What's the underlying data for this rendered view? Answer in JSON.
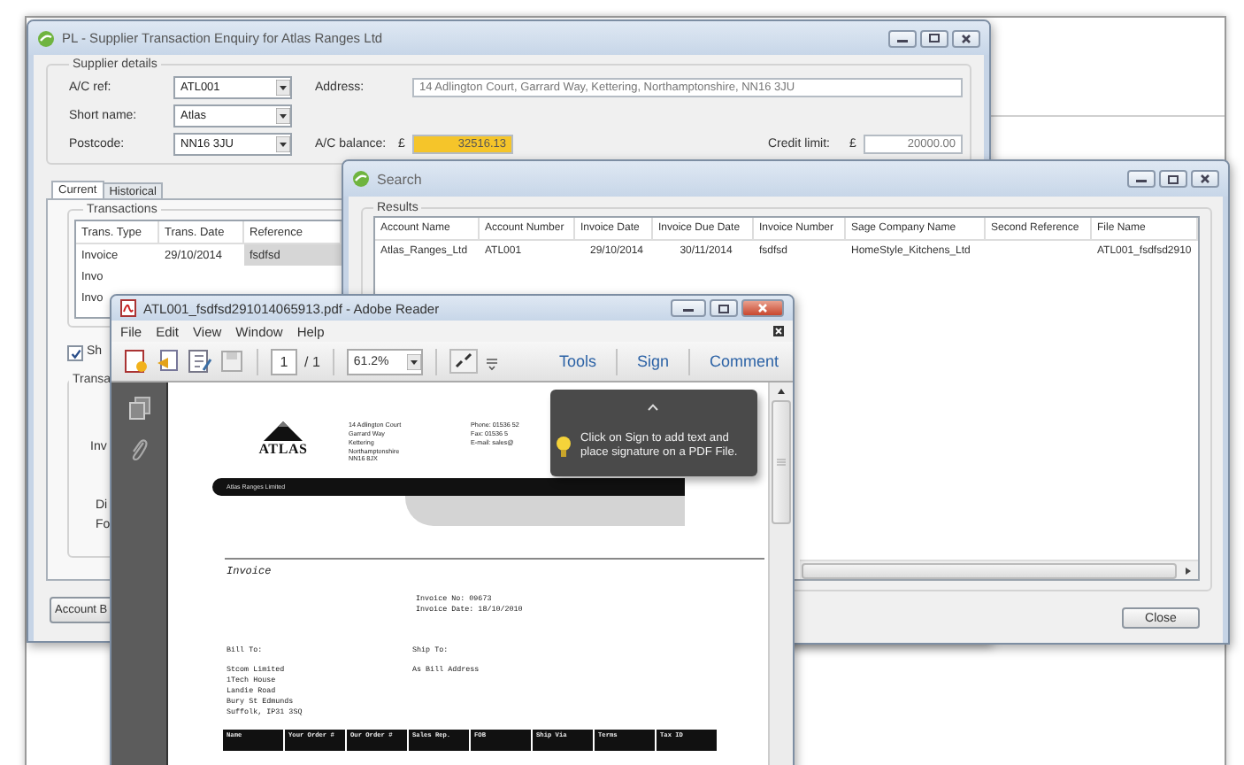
{
  "main_window": {
    "title": "PL - Supplier Transaction Enquiry for Atlas Ranges Ltd",
    "supplier_details": {
      "label": "Supplier details",
      "fields": [
        {
          "label": "A/C ref:",
          "value": "ATL001"
        },
        {
          "label": "Short name:",
          "value": "Atlas"
        },
        {
          "label": "Postcode:",
          "value": "NN16 3JU"
        }
      ],
      "address_label": "Address:",
      "address": "14 Adlington Court, Garrard Way, Kettering, Northamptonshire, NN16 3JU",
      "balance_label": "A/C balance:",
      "balance_currency": "£",
      "balance": "32516.13",
      "credit_label": "Credit limit:",
      "credit_currency": "£",
      "credit": "20000.00"
    },
    "tabs": [
      {
        "label": "Current",
        "selected": true
      },
      {
        "label": "Historical",
        "selected": false
      }
    ],
    "transactions": {
      "label": "Transactions",
      "columns": [
        "Trans. Type",
        "Trans. Date",
        "Reference"
      ],
      "rows": [
        {
          "cells": [
            {
              "text": "Invoice",
              "selected": false
            },
            {
              "text": "29/10/2014",
              "selected": false
            },
            {
              "text": "fsdfsd",
              "selected": true
            }
          ]
        },
        {
          "cells": [
            {
              "text": "Invo",
              "selected": false
            }
          ]
        },
        {
          "cells": [
            {
              "text": "Invo",
              "selected": false
            }
          ]
        }
      ]
    },
    "show_checkbox": {
      "label": "Sh",
      "checked": true
    },
    "details": {
      "label": "Transa",
      "lines": [
        "Inv",
        "Di",
        "Fo"
      ]
    },
    "buttons": [
      "Account B"
    ]
  },
  "search_window": {
    "title": "Search",
    "results_label": "Results",
    "columns": [
      "Account Name",
      "Account Number",
      "Invoice Date",
      "Invoice Due Date",
      "Invoice Number",
      "Sage Company Name",
      "Second Reference",
      "File Name"
    ],
    "rows": [
      [
        "Atlas_Ranges_Ltd",
        "ATL001",
        "29/10/2014",
        "30/11/2014",
        "fsdfsd",
        "HomeStyle_Kitchens_Ltd",
        "",
        "ATL001_fsdfsd2910"
      ]
    ],
    "buttons": [
      "Close"
    ]
  },
  "reader_window": {
    "title": "ATL001_fsdfsd291014065913.pdf - Adobe Reader",
    "menu": [
      "File",
      "Edit",
      "View",
      "Window",
      "Help"
    ],
    "page_field": "1",
    "page_total": "/ 1",
    "zoom": "61.2%",
    "tool_tabs": [
      "Tools",
      "Sign",
      "Comment"
    ],
    "tooltip": "Click on Sign to add text and place signature on a PDF File.",
    "document": {
      "logo": "ATLAS",
      "company_address": [
        "14 Adlington Court",
        "Garrard Way",
        "Kettering",
        "Northamptonshire",
        "NN16 8JX"
      ],
      "contact": [
        "Phone: 01536 52",
        "Fax: 01536 5",
        "E-mail: sales@"
      ],
      "band_text": "Atlas Ranges Limited",
      "heading": "Invoice",
      "invoice_info": [
        "Invoice No: 09673",
        "Invoice Date: 18/10/2010"
      ],
      "bill_to_label": "Bill To:",
      "bill_to": [
        "Stcom Limited",
        "1Tech House",
        "Landie Road",
        "Bury St Edmunds",
        "Suffolk, IP31 3SQ"
      ],
      "ship_to_label": "Ship To:",
      "ship_to": "As Bill Address",
      "table_columns": [
        "Name",
        "Your Order #",
        "Our Order #",
        "Sales Rep.",
        "FOB",
        "Ship Via",
        "Terms",
        "Tax ID"
      ]
    }
  }
}
